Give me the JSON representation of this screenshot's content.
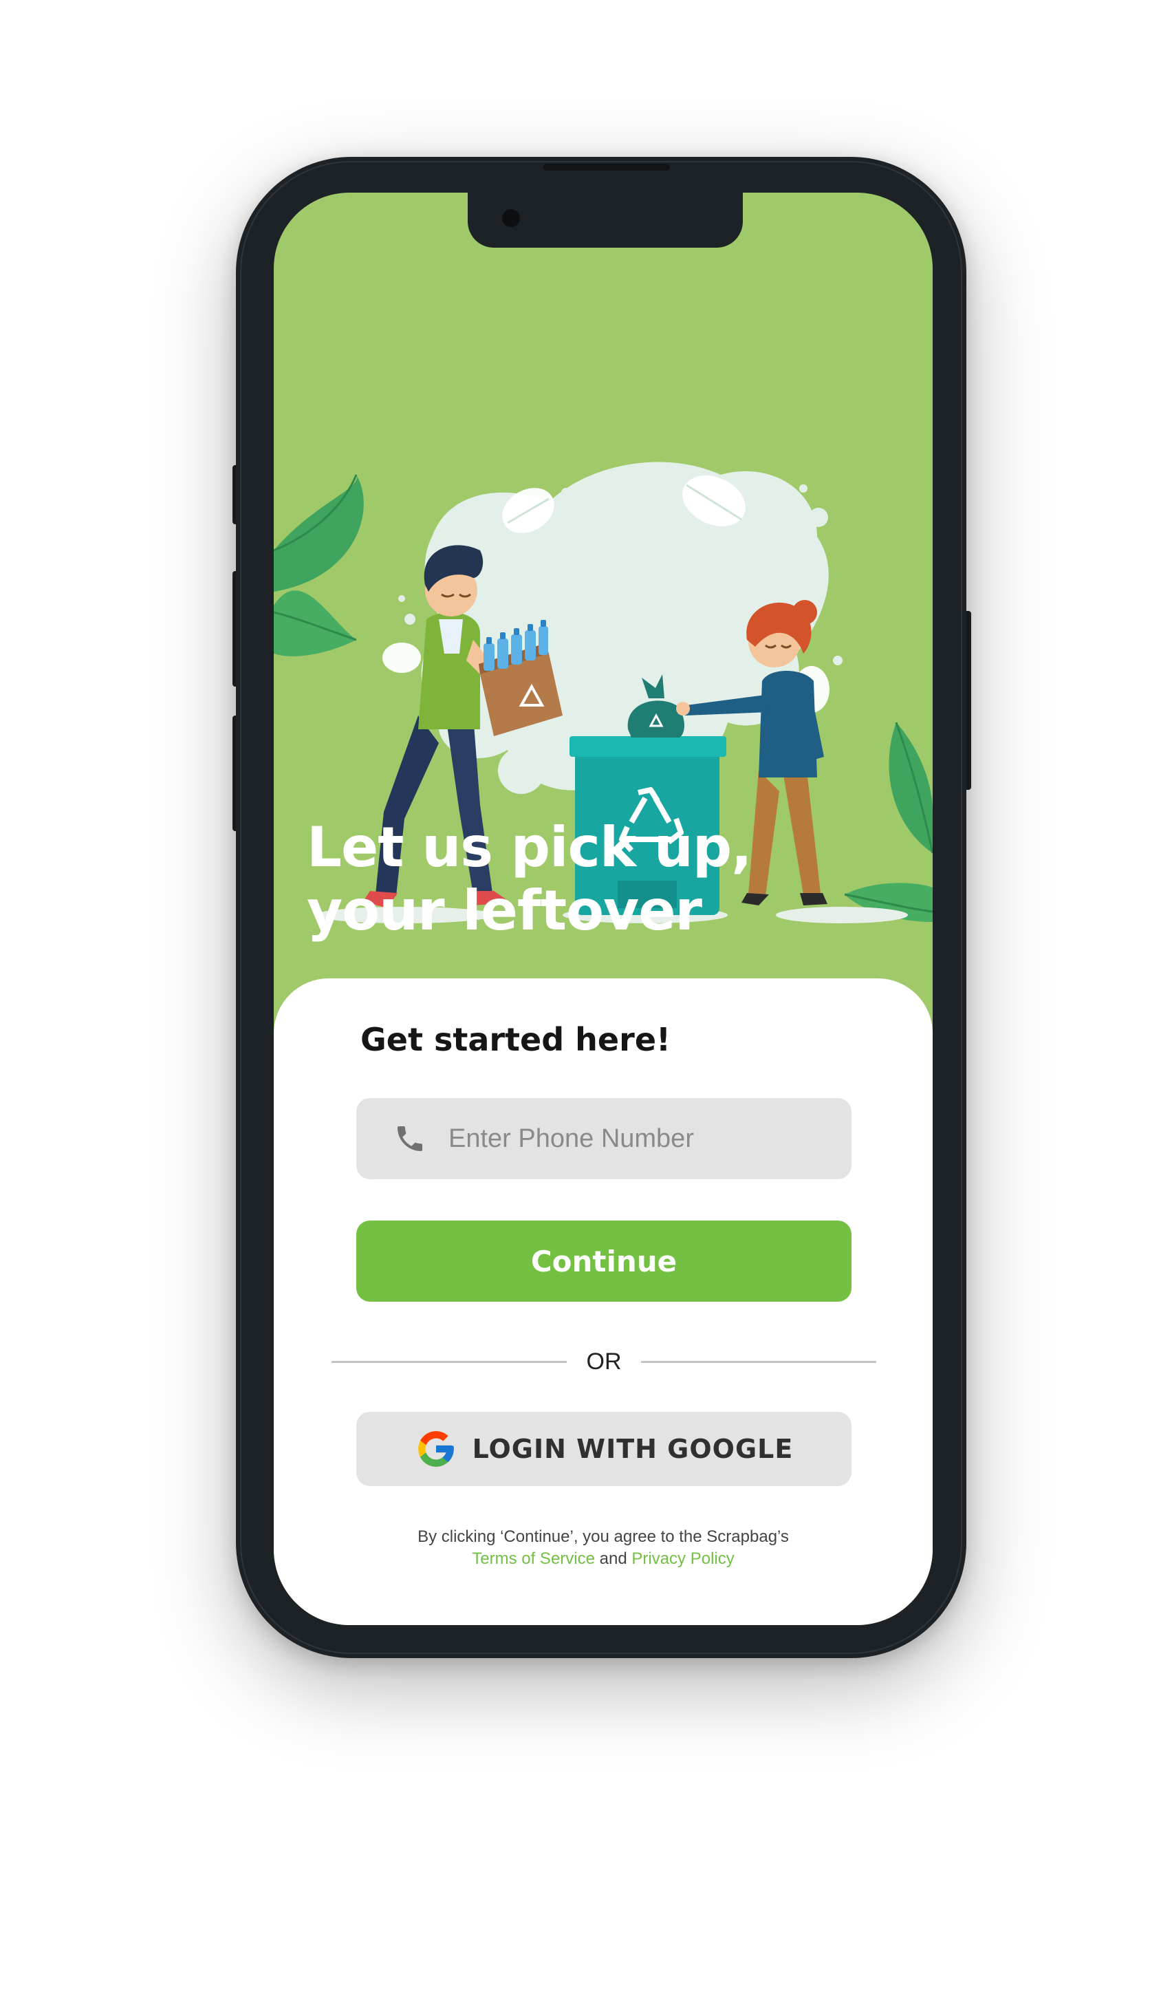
{
  "hero": {
    "title_line1": "Let us pick up,",
    "title_line2": "your leftover"
  },
  "signup": {
    "heading": "Get started here!",
    "phone_placeholder": "Enter Phone Number",
    "continue_label": "Continue",
    "divider_label": "OR",
    "google_label": "LOGIN WITH GOOGLE",
    "legal_prefix": "By clicking ‘Continue’, you agree to the Scrapbag’s",
    "terms_label": "Terms of Service",
    "legal_and": "and",
    "privacy_label": "Privacy Policy"
  },
  "icons": {
    "phone": "phone-icon",
    "google": "google-icon",
    "recycle": "recycle-icon"
  },
  "colors": {
    "screen_background": "#a0c969",
    "accent_green": "#73c043",
    "input_background": "#e3e3e3",
    "phone_frame": "#1d2226",
    "bin_teal": "#17a6a0"
  }
}
